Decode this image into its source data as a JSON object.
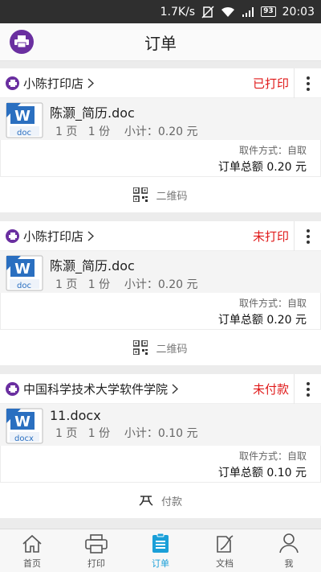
{
  "status_bar": {
    "speed": "1.7K/s",
    "battery": "93",
    "time": "20:03"
  },
  "header": {
    "title": "订单"
  },
  "orders": [
    {
      "shop": "小陈打印店",
      "status": "已打印",
      "file": {
        "name": "陈灏_简历.doc",
        "type_label": "doc",
        "meta": "1 页   1 份    小计：0.20 元"
      },
      "pickup": "取件方式：自取",
      "total": "订单总额 0.20 元",
      "action": "二维码"
    },
    {
      "shop": "小陈打印店",
      "status": "未打印",
      "file": {
        "name": "陈灏_简历.doc",
        "type_label": "doc",
        "meta": "1 页   1 份    小计：0.20 元"
      },
      "pickup": "取件方式：自取",
      "total": "订单总额 0.20 元",
      "action": "二维码"
    },
    {
      "shop": "中国科学技术大学软件学院",
      "status": "未付款",
      "file": {
        "name": "11.docx",
        "type_label": "docx",
        "meta": "1 页   1 份    小计：0.10 元"
      },
      "pickup": "取件方式：自取",
      "total": "订单总额 0.10 元",
      "action": "付款"
    }
  ],
  "tabbar": {
    "items": [
      {
        "label": "首页",
        "icon": "home-icon"
      },
      {
        "label": "打印",
        "icon": "printer-icon"
      },
      {
        "label": "订单",
        "icon": "order-icon",
        "active": true
      },
      {
        "label": "文档",
        "icon": "document-icon"
      },
      {
        "label": "我",
        "icon": "user-icon"
      }
    ]
  },
  "colors": {
    "brand": "#6a2fa0",
    "status_red": "#e01a1a",
    "tab_active": "#1a9fd8"
  }
}
